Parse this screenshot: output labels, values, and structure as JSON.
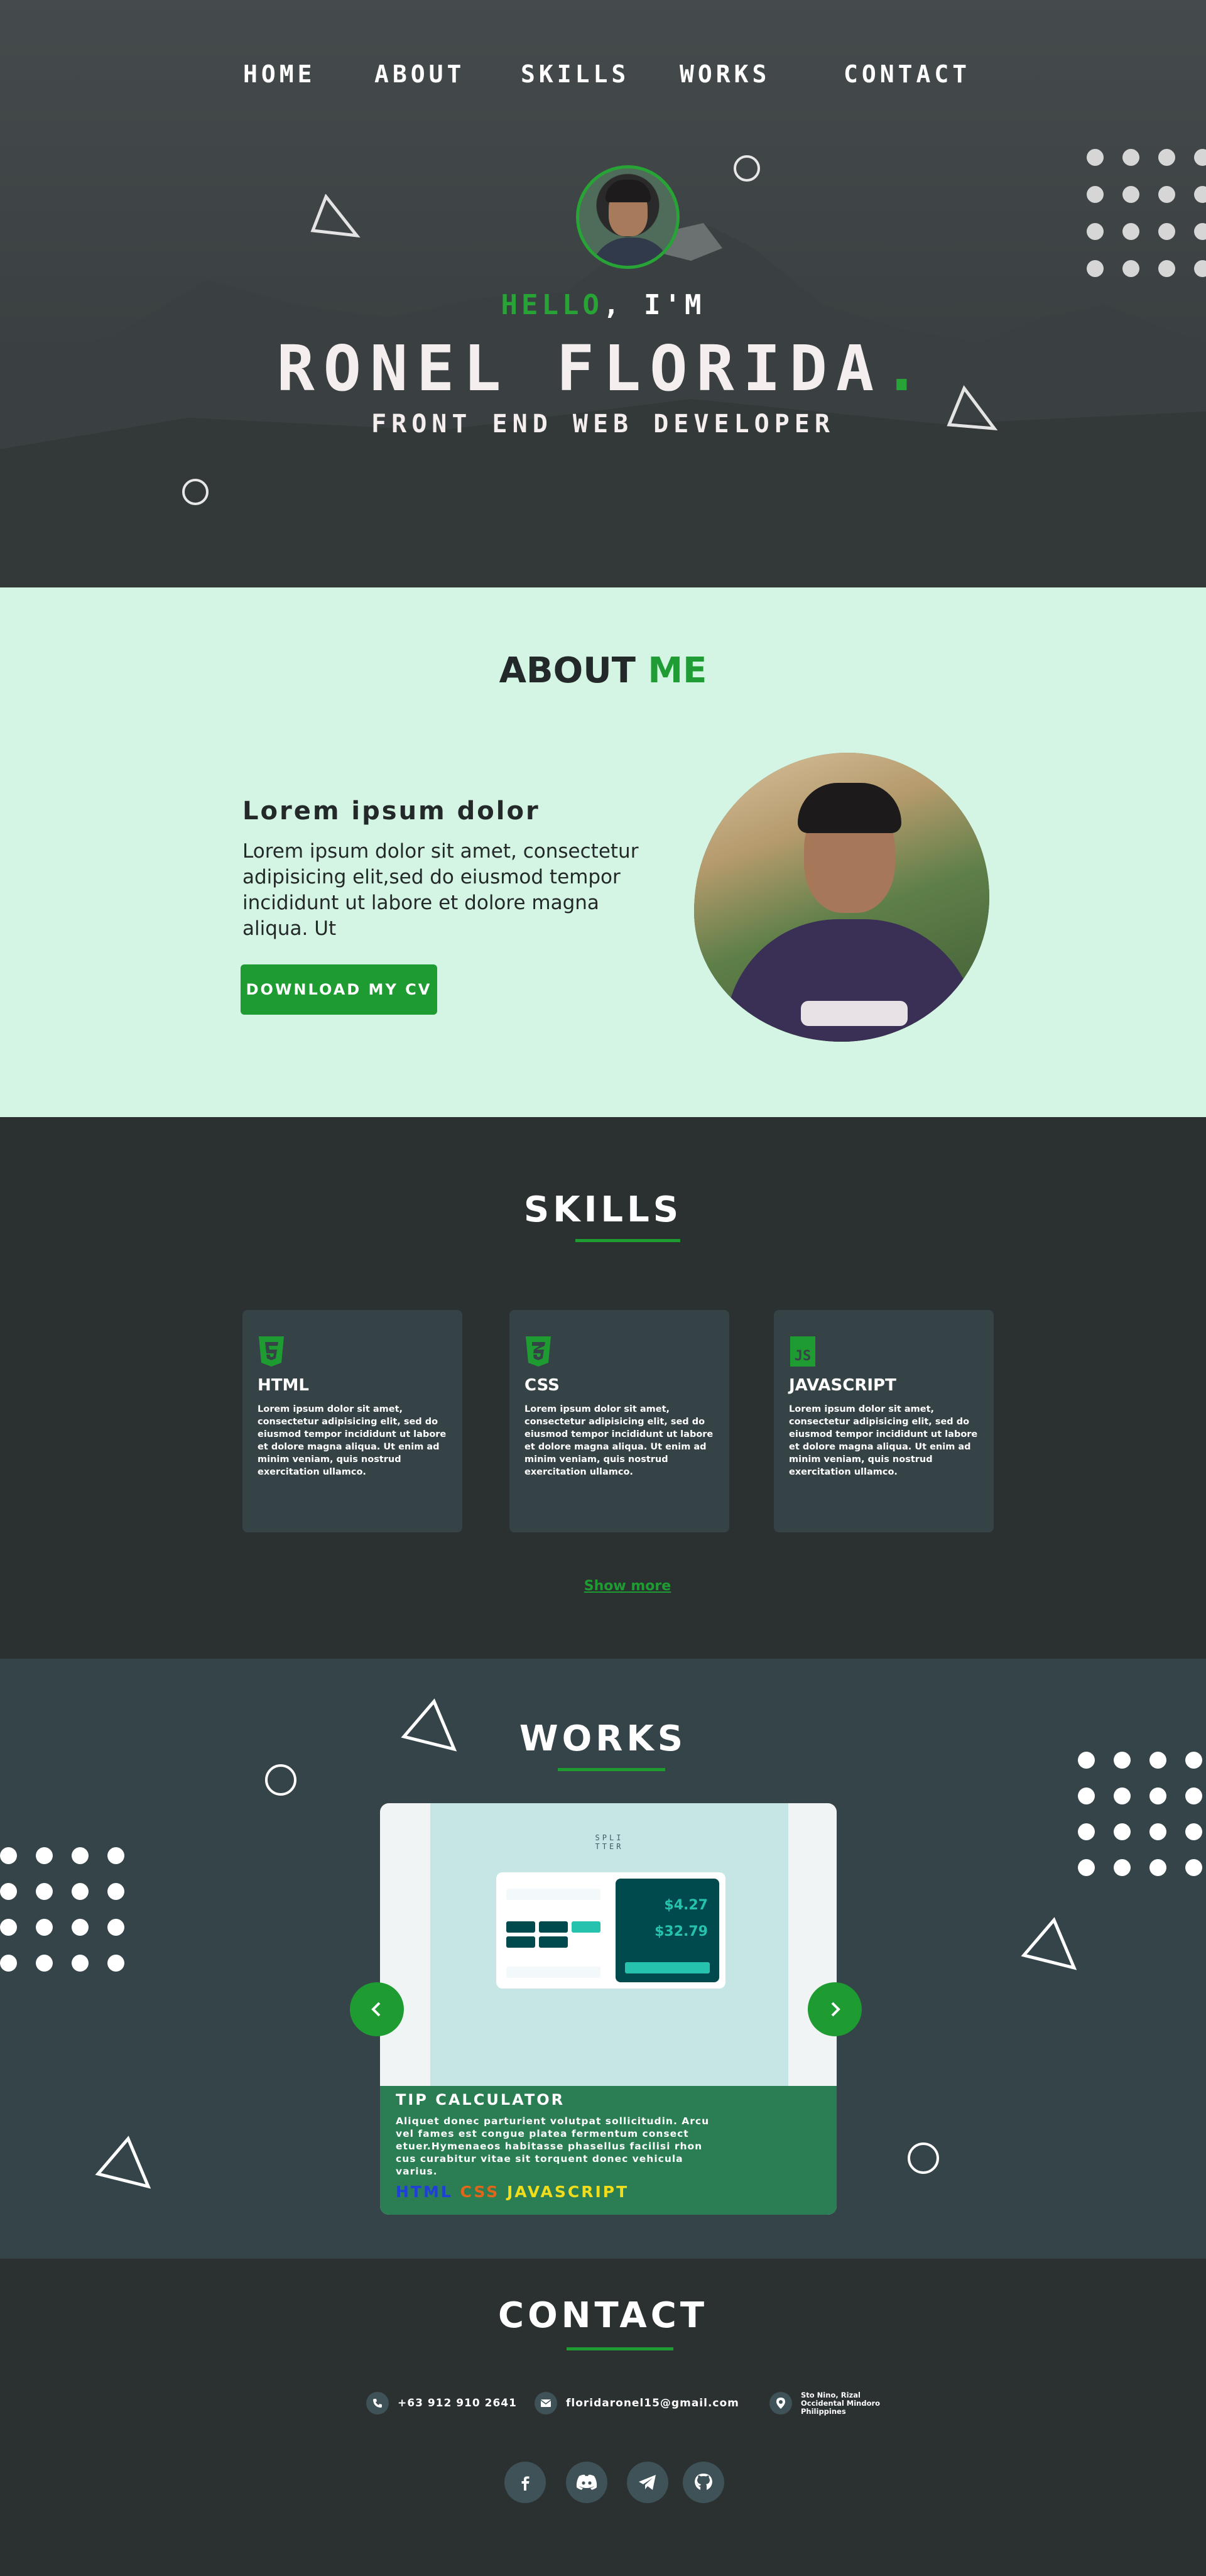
{
  "nav": {
    "items": [
      "HOME",
      "ABOUT",
      "SKILLS",
      "WORKS",
      "CONTACT"
    ]
  },
  "hero": {
    "hello": "HELLO",
    "im": ", I'M",
    "name": "RONEL FLORIDA",
    "name_dot": ".",
    "role": "FRONT END WEB DEVELOPER"
  },
  "about": {
    "title": "ABOUT",
    "title_accent": "ME",
    "heading": "Lorem ipsum dolor",
    "body": "Lorem ipsum dolor sit amet, consectetur adipisicing elit,sed do eiusmod tempor incididunt ut labore et dolore magna  aliqua. Ut",
    "cv_button": "DOWNLOAD MY CV"
  },
  "skills": {
    "title": "SKILLS",
    "cards": [
      {
        "name": "HTML",
        "icon": "html5-icon",
        "desc": "Lorem ipsum dolor sit amet, consectetur adipisicing elit, sed do eiusmod tempor incididunt ut labore et dolore magna aliqua. Ut enim  ad minim veniam, quis nostrud exercitation ullamco."
      },
      {
        "name": "CSS",
        "icon": "css3-icon",
        "desc": "Lorem ipsum dolor sit amet, consectetur adipisicing elit, sed do eiusmod tempor incididunt ut labore et dolore magna aliqua. Ut enim  ad minim veniam, quis nostrud exercitation ullamco."
      },
      {
        "name": "JAVASCRIPT",
        "icon": "js-icon",
        "desc": "Lorem ipsum dolor sit amet, consectetur adipisicing elit, sed do eiusmod tempor incididunt ut labore et dolore magna aliqua. Ut enim  ad minim veniam, quis nostrud exercitation ullamco."
      }
    ],
    "show_more": "Show more"
  },
  "works": {
    "title": "WORKS",
    "project": {
      "brand_line1": "SPLI",
      "brand_line2": "TTER",
      "amount1": "$4.27",
      "amount2": "$32.79",
      "title": "TIP CALCULATOR",
      "desc": "Aliquet donec parturient volutpat sollicitudin. Arcu vel fames est congue platea fermentum consect etuer.Hymenaeos habitasse phasellus facilisi rhon cus curabitur vitae sit torquent donec vehicula varius.",
      "tags": [
        {
          "label": "HTML",
          "color": "#1f3fd6"
        },
        {
          "label": "CSS",
          "color": "#e0661a"
        },
        {
          "label": "JAVASCRIPT",
          "color": "#f2dd1c"
        }
      ]
    }
  },
  "contact": {
    "title": "CONTACT",
    "phone": "+63 912 910 2641",
    "email": "floridaronel15@gmail.com",
    "location_lines": [
      "Sto Nino, Rizal",
      "Occidental Mindoro",
      "Philippines"
    ],
    "socials": [
      "facebook-icon",
      "discord-icon",
      "telegram-icon",
      "github-icon"
    ]
  },
  "colors": {
    "accent": "#1e9c32",
    "about_bg": "#d4f5e4",
    "dark_bg": "#2b3131",
    "card_bg": "#354246"
  }
}
